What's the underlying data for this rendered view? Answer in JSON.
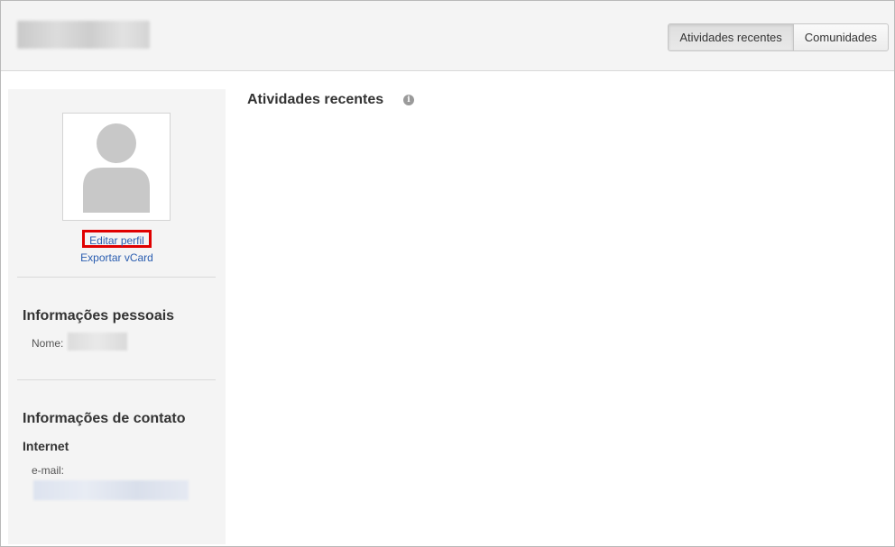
{
  "header": {
    "tabs": [
      {
        "label": "Atividades recentes",
        "active": true
      },
      {
        "label": "Comunidades",
        "active": false
      }
    ]
  },
  "sidebar": {
    "edit_profile": "Editar perfil",
    "export_vcard": "Exportar vCard",
    "personal": {
      "title": "Informações pessoais",
      "name_label": "Nome:"
    },
    "contact": {
      "title": "Informações de contato",
      "internet_label": "Internet",
      "email_label": "e-mail:"
    }
  },
  "main": {
    "title": "Atividades recentes",
    "info_icon": "i"
  },
  "colors": {
    "link": "#2a5db0",
    "highlight": "#e00000"
  }
}
